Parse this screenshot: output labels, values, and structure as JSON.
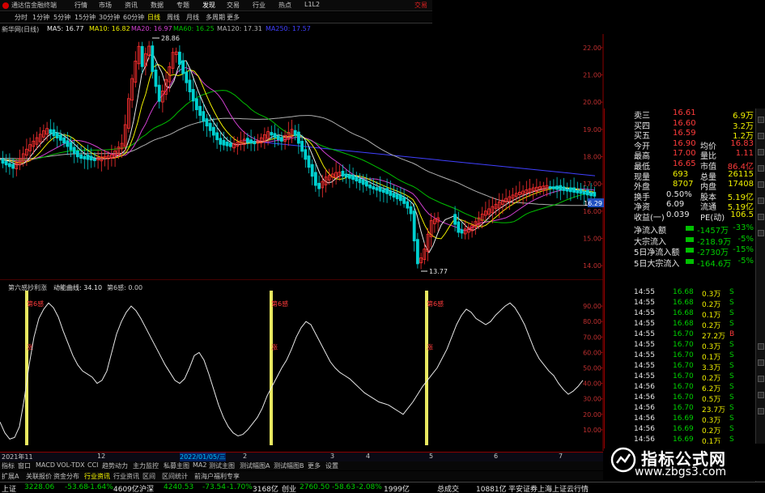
{
  "titlebar": {
    "title": "通达信金融终端",
    "menus": [
      "行情",
      "市场",
      "资讯",
      "数据",
      "专题",
      "发现",
      "交易",
      "行业",
      "热点",
      "L1L2"
    ],
    "active": "发现",
    "right": "交易"
  },
  "toolbar": {
    "items": [
      "分时",
      "1分钟",
      "5分钟",
      "15分钟",
      "30分钟",
      "60分钟",
      "日线",
      "周线",
      "月线",
      "多周期",
      "更多"
    ],
    "active": "日线"
  },
  "ma_line": {
    "label": "新华网(日线)",
    "items": [
      {
        "text": "MA5: 16.77",
        "color": "#e8e8e8"
      },
      {
        "text": "MA10: 16.82",
        "color": "#f0f000"
      },
      {
        "text": "MA20: 16.97",
        "color": "#d040d0"
      },
      {
        "text": "MA60: 16.25",
        "color": "#00c000"
      },
      {
        "text": "MA120: 17.31",
        "color": "#b0b0b0"
      },
      {
        "text": "MA250: 17.57",
        "color": "#4040ff"
      }
    ]
  },
  "indicator": {
    "name": "第六感抄利涨",
    "line_label": "动能曲线: 34.10",
    "count_label": "第6感: 0.00",
    "signal_label": "第6感",
    "sub_label": "涨"
  },
  "axis": {
    "dates": [
      "2021年11",
      "12",
      "2022/01/05/三",
      "2",
      "3",
      "4",
      "5",
      "6",
      "7"
    ]
  },
  "tabs": [
    "指标",
    "窗口",
    "MACD",
    "VOL-TDX",
    "CCI",
    "趋势动力",
    "主力监控",
    "私募主图",
    "MA2",
    "测试主图",
    "测试幅图A",
    "测试幅图B",
    "更多",
    "设置"
  ],
  "tabs2": [
    "扩展A",
    "关联报价",
    "资金分布",
    "行业资讯",
    "行业资讯",
    "区间",
    "区间统计",
    "前海户福利专享"
  ],
  "quote": {
    "rows": [
      {
        "label": "卖三",
        "value": "16.61",
        "vol": "6.9万"
      },
      {
        "label": "买四",
        "value": "16.60",
        "vol": "3.2万"
      },
      {
        "label": "买五",
        "value": "16.59",
        "vol": "1.2万"
      },
      {
        "label": "今开",
        "value": "16.90",
        "label2": "均价",
        "value2": "16.83"
      },
      {
        "label": "最高",
        "value": "17.00",
        "label2": "量比",
        "value2": "1.11"
      },
      {
        "label": "最低",
        "value": "16.65",
        "label2": "市值",
        "value2": "86.4亿"
      },
      {
        "label": "现量",
        "value": "693",
        "label2": "总量",
        "value2": "26115"
      },
      {
        "label": "外盘",
        "value": "8707",
        "label2": "内盘",
        "value2": "17408"
      },
      {
        "label": "换手",
        "value": "0.50%",
        "label2": "股本",
        "value2": "5.19亿"
      },
      {
        "label": "净资",
        "value": "6.09",
        "label2": "流通",
        "value2": "5.19亿"
      },
      {
        "label": "收益(一)",
        "value": "0.039",
        "label2": "PE(动)",
        "value2": "106.5"
      }
    ]
  },
  "flow": [
    {
      "label": "净流入额",
      "value": "-1457万",
      "pct": "-33%"
    },
    {
      "label": "大宗流入",
      "value": "-218.9万",
      "pct": "-5%"
    },
    {
      "label": "5日净流入额",
      "value": "-2730万",
      "pct": "-15%"
    },
    {
      "label": "5日大宗流入",
      "value": "-164.6万",
      "pct": "-5%"
    }
  ],
  "ticks": [
    {
      "t": "14:55",
      "p": "16.68",
      "v": "0.3万",
      "s": "S"
    },
    {
      "t": "14:55",
      "p": "16.68",
      "v": "0.2万",
      "s": "S"
    },
    {
      "t": "14:55",
      "p": "16.68",
      "v": "0.1万",
      "s": "S"
    },
    {
      "t": "14:55",
      "p": "16.68",
      "v": "0.2万",
      "s": "S"
    },
    {
      "t": "14:55",
      "p": "16.70",
      "v": "27.2万",
      "s": "B"
    },
    {
      "t": "14:55",
      "p": "16.70",
      "v": "0.3万",
      "s": "S"
    },
    {
      "t": "14:55",
      "p": "16.70",
      "v": "0.1万",
      "s": "S"
    },
    {
      "t": "14:55",
      "p": "16.70",
      "v": "3.3万",
      "s": "S"
    },
    {
      "t": "14:55",
      "p": "16.70",
      "v": "0.2万",
      "s": "S"
    },
    {
      "t": "14:56",
      "p": "16.70",
      "v": "6.2万",
      "s": "S"
    },
    {
      "t": "14:56",
      "p": "16.70",
      "v": "0.5万",
      "s": "S"
    },
    {
      "t": "14:56",
      "p": "16.70",
      "v": "23.7万",
      "s": "S"
    },
    {
      "t": "14:56",
      "p": "16.69",
      "v": "0.3万",
      "s": "S"
    },
    {
      "t": "14:56",
      "p": "16.69",
      "v": "0.2万",
      "s": "S"
    },
    {
      "t": "14:56",
      "p": "16.69",
      "v": "0.1万",
      "s": "S"
    }
  ],
  "status": {
    "items": [
      {
        "text": "上证",
        "color": "#e6e6e6"
      },
      {
        "text": "3228.06",
        "color": "#00d000"
      },
      {
        "text": "-53.68",
        "color": "#00d000"
      },
      {
        "text": "-1.64%",
        "color": "#00d000"
      },
      {
        "text": "4609亿",
        "color": "#e6e6e6"
      },
      {
        "text": "沪深",
        "color": "#e6e6e6"
      },
      {
        "text": "4240.53",
        "color": "#00d000"
      },
      {
        "text": "-73.54",
        "color": "#00d000"
      },
      {
        "text": "-1.70%",
        "color": "#00d000"
      },
      {
        "text": "3168亿",
        "color": "#e6e6e6"
      },
      {
        "text": "创业",
        "color": "#e6e6e6"
      },
      {
        "text": "2760.50",
        "color": "#00d000"
      },
      {
        "text": "-58.63",
        "color": "#00d000"
      },
      {
        "text": "-2.08%",
        "color": "#00d000"
      },
      {
        "text": "1999亿",
        "color": "#e6e6e6"
      },
      {
        "text": "总成交",
        "color": "#e6e6e6"
      },
      {
        "text": "10881亿",
        "color": "#e6e6e6"
      },
      {
        "text": "平安证券上海上证云行情",
        "color": "#e6e6e6"
      }
    ]
  },
  "watermark": {
    "title": "指标公式网",
    "url": "www.zbgs3.com"
  },
  "chart_data": [
    {
      "type": "candlestick",
      "title": "",
      "ylim": [
        13.5,
        22.5
      ],
      "yticks": [
        "22.00",
        "21.00",
        "20.00",
        "19.00",
        "18.00",
        "17.00",
        "16.00",
        "15.00",
        "14.00"
      ],
      "annotations": [
        {
          "text": "28.86",
          "at": "peak"
        },
        {
          "text": "13.77",
          "at": "trough"
        },
        {
          "text": "16.29",
          "at": "last"
        }
      ],
      "series": [
        {
          "name": "MA5",
          "color": "#e8e8e8"
        },
        {
          "name": "MA10",
          "color": "#f0f000"
        },
        {
          "name": "MA20",
          "color": "#d040d0"
        },
        {
          "name": "MA60",
          "color": "#00c000"
        },
        {
          "name": "MA120",
          "color": "#b0b0b0"
        },
        {
          "name": "MA250",
          "color": "#4040ff"
        }
      ]
    },
    {
      "type": "line",
      "title": "",
      "ylim": [
        0,
        100
      ],
      "yticks": [
        "90.00",
        "80.00",
        "70.00",
        "60.00",
        "50.00",
        "40.00",
        "30.00",
        "20.00",
        "10.00"
      ],
      "x": [
        0,
        6,
        12,
        18,
        24,
        30,
        36,
        42,
        48,
        54,
        60,
        66,
        72,
        78,
        84,
        90,
        96,
        102,
        108,
        114,
        120,
        126,
        132,
        138,
        144,
        150,
        156,
        162,
        168,
        174,
        180,
        186,
        192,
        198,
        204,
        210,
        216,
        222,
        228,
        234,
        240,
        246,
        252,
        258,
        264,
        270,
        276,
        282,
        288,
        294,
        300,
        306,
        312,
        318,
        324,
        330,
        336,
        342,
        348,
        354,
        360,
        366,
        372,
        378,
        384,
        390,
        396,
        402,
        408,
        414,
        420,
        426,
        432,
        438,
        444,
        450,
        456,
        462,
        468,
        474,
        480,
        486,
        492,
        498,
        504,
        510,
        516,
        522,
        528,
        534,
        540,
        546,
        552,
        558,
        564,
        570,
        576,
        582,
        588,
        594,
        600,
        606,
        612,
        618,
        624,
        630,
        636,
        642,
        648,
        654,
        660,
        666,
        672,
        678,
        684,
        690,
        696,
        702,
        708,
        714,
        720,
        726,
        732
      ],
      "values": [
        15,
        8,
        4,
        5,
        12,
        30,
        52,
        70,
        82,
        88,
        92,
        89,
        83,
        74,
        66,
        58,
        52,
        48,
        46,
        44,
        40,
        42,
        48,
        60,
        72,
        80,
        86,
        90,
        87,
        82,
        76,
        70,
        64,
        58,
        52,
        47,
        42,
        40,
        43,
        50,
        58,
        60,
        55,
        46,
        36,
        26,
        18,
        12,
        8,
        6,
        7,
        10,
        14,
        18,
        24,
        32,
        38,
        44,
        50,
        55,
        62,
        70,
        76,
        80,
        78,
        72,
        66,
        60,
        54,
        50,
        47,
        45,
        43,
        40,
        37,
        34,
        32,
        30,
        28,
        27,
        26,
        24,
        22,
        20,
        24,
        28,
        33,
        38,
        42,
        46,
        50,
        56,
        62,
        70,
        78,
        84,
        88,
        86,
        82,
        80,
        78,
        80,
        84,
        87,
        90,
        92,
        89,
        84,
        78,
        70,
        62,
        56,
        52,
        48,
        45,
        40,
        36,
        33,
        35,
        38,
        42
      ],
      "signals": [
        31,
        333,
        525
      ],
      "series": [
        {
          "name": "动能曲线",
          "color": "#e8e8e8"
        }
      ]
    }
  ]
}
